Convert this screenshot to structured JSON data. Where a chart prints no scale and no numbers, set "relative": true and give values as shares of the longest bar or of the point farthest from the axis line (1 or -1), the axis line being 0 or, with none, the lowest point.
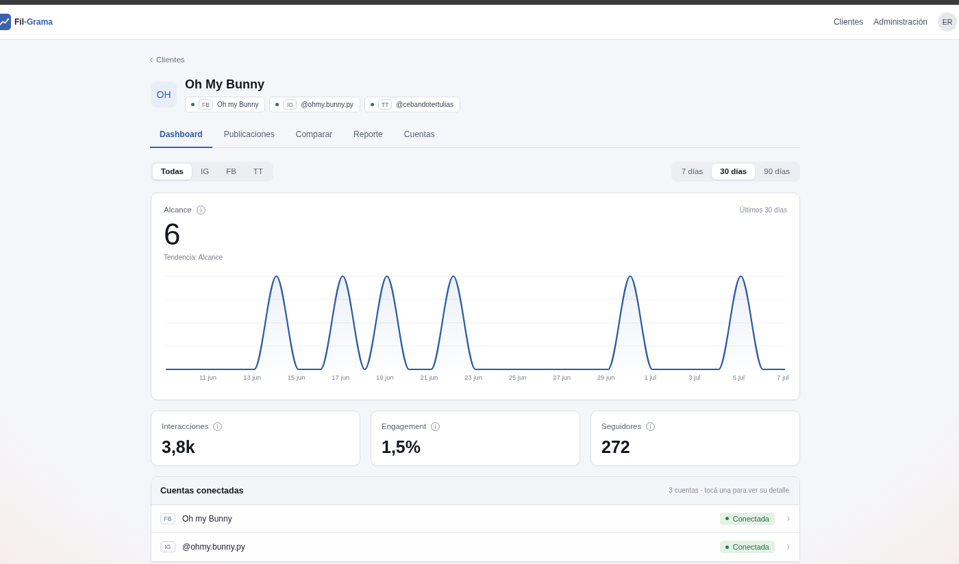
{
  "header": {
    "brand": {
      "part_1": "Fil",
      "part_2": "-Grama"
    },
    "nav": [
      "Clientes",
      "Administración"
    ],
    "user_initials": "ER"
  },
  "breadcrumb": "Clientes",
  "client": {
    "initials": "OH",
    "name": "Oh My Bunny",
    "accounts": [
      {
        "platform": "FB",
        "name": "Oh my Bunny",
        "connected": true
      },
      {
        "platform": "IG",
        "name": "@ohmy.bunny.py",
        "connected": true
      },
      {
        "platform": "TT",
        "name": "@cebandotertulias",
        "connected": true
      }
    ]
  },
  "tabs": [
    {
      "label": "Dashboard",
      "selected": true
    },
    {
      "label": "Publicaciones",
      "selected": false
    },
    {
      "label": "Comparar",
      "selected": false
    },
    {
      "label": "Reporte",
      "selected": false
    },
    {
      "label": "Cuentas",
      "selected": false
    }
  ],
  "platform_filter": [
    {
      "label": "Todas",
      "selected": true
    },
    {
      "label": "IG",
      "selected": false
    },
    {
      "label": "FB",
      "selected": false
    },
    {
      "label": "TT",
      "selected": false
    }
  ],
  "period_filter": [
    {
      "label": "7 días",
      "selected": false
    },
    {
      "label": "30 días",
      "selected": true
    },
    {
      "label": "90 días",
      "selected": false
    }
  ],
  "reach_card": {
    "label": "Alcance",
    "period": "Últimos 30 días",
    "value": "6",
    "chart_data": {
      "type": "area",
      "title": "Tendencia: Alcance",
      "relative": true,
      "categories": [
        null,
        null,
        "11 jun",
        null,
        "13 jun",
        null,
        "15 jun",
        null,
        "17 jun",
        null,
        "19 jun",
        null,
        "21 jun",
        null,
        "23 jun",
        null,
        "25 jun",
        null,
        "27 jun",
        null,
        "29 jun",
        null,
        "1 jul",
        null,
        "3 jul",
        null,
        "5 jul",
        null,
        "7 jul"
      ],
      "series": [
        {
          "color": "#2d5aa7",
          "values": [
            0,
            0,
            0,
            0,
            0,
            1,
            0,
            0,
            1,
            0,
            1,
            0,
            0,
            1,
            0,
            0,
            0,
            0,
            0,
            0,
            0,
            1,
            0,
            0,
            0,
            0,
            1,
            0,
            0
          ]
        }
      ]
    }
  },
  "stats": [
    {
      "label": "Interacciones",
      "value": "3,8k"
    },
    {
      "label": "Engagement",
      "value": "1,5%"
    },
    {
      "label": "Seguidores",
      "value": "272"
    }
  ],
  "connected_accounts": {
    "title": "Cuentas conectadas",
    "hint": "3 cuentas · tocá una para ver su detalle",
    "rows": [
      {
        "platform": "FB",
        "name": "Oh my Bunny",
        "status": "Conectada",
        "connected": true
      },
      {
        "platform": "IG",
        "name": "@ohmy.bunny.py",
        "status": "Conectada",
        "connected": true
      }
    ]
  }
}
